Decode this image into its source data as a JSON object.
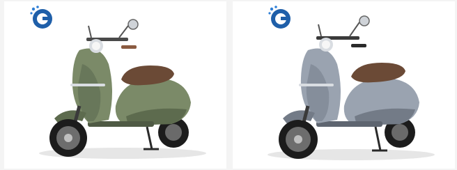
{
  "gallery": {
    "items": [
      {
        "logo": "g-dots-logo",
        "product": "electric-scooter",
        "body_color": "#7b8a68",
        "body_shade": "#5d6b4e",
        "seat_color": "#6b4a36"
      },
      {
        "logo": "g-dots-logo",
        "product": "electric-scooter",
        "body_color": "#9aa3b0",
        "body_shade": "#737b87",
        "seat_color": "#6b4a36"
      }
    ]
  },
  "colors": {
    "logo_blue": "#1f5fa9",
    "logo_accent": "#2f7fd6",
    "tire": "#1c1c1c",
    "chrome": "#d9dde2"
  }
}
